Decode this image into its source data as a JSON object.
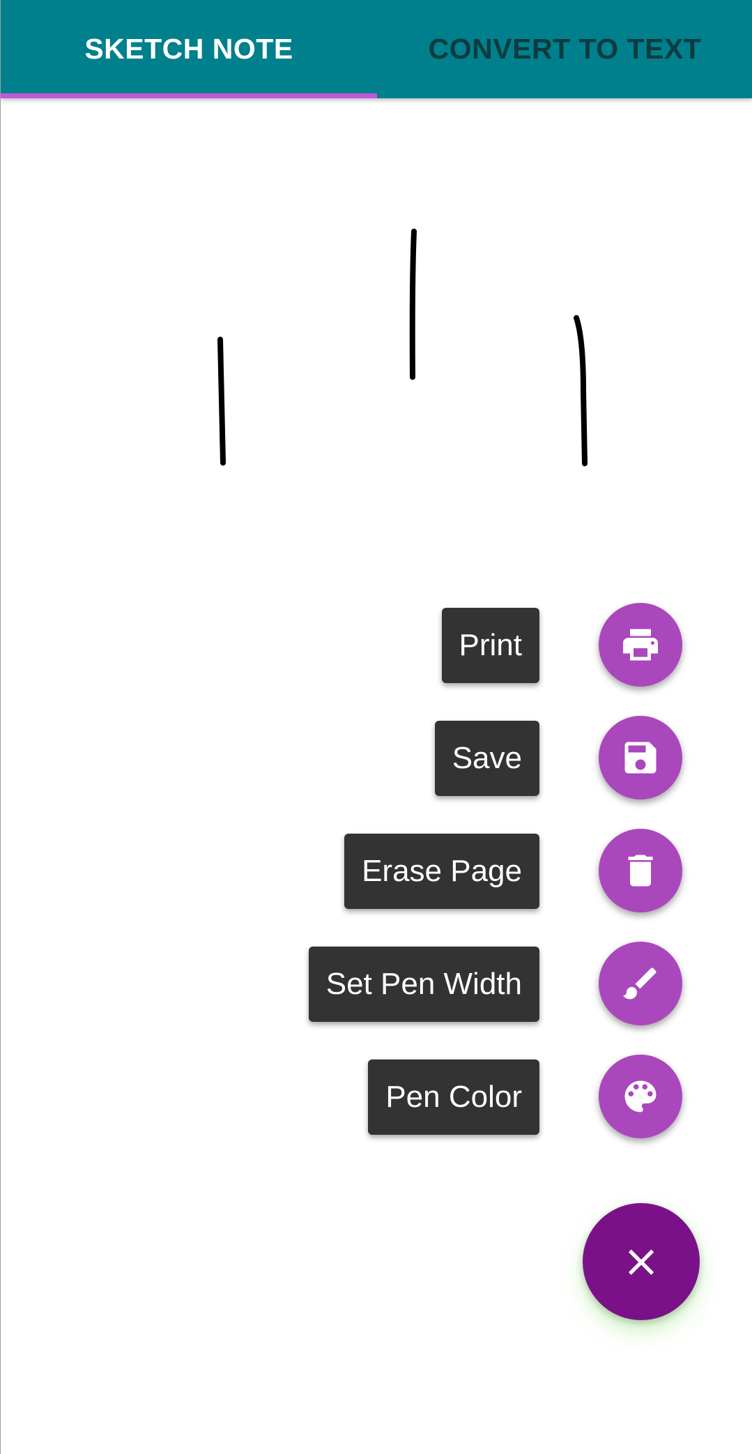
{
  "tabs": [
    {
      "label": "SKETCH NOTE",
      "selected": true
    },
    {
      "label": "CONVERT TO TEXT",
      "selected": false
    }
  ],
  "colors": {
    "tabbar": "#00808c",
    "indicator": "#c058d8",
    "mini_fab": "#ab47bc",
    "main_fab": "#7b1189",
    "label_bg": "#333333",
    "ink": "#000000"
  },
  "menu": {
    "items": [
      {
        "label": "Print",
        "icon": "printer-icon"
      },
      {
        "label": "Save",
        "icon": "floppy-disk-icon"
      },
      {
        "label": "Erase Page",
        "icon": "trash-icon"
      },
      {
        "label": "Set Pen Width",
        "icon": "brush-icon"
      },
      {
        "label": "Pen Color",
        "icon": "palette-icon"
      }
    ]
  },
  "main_fab": {
    "glyph": "×",
    "icon": "close-icon"
  }
}
